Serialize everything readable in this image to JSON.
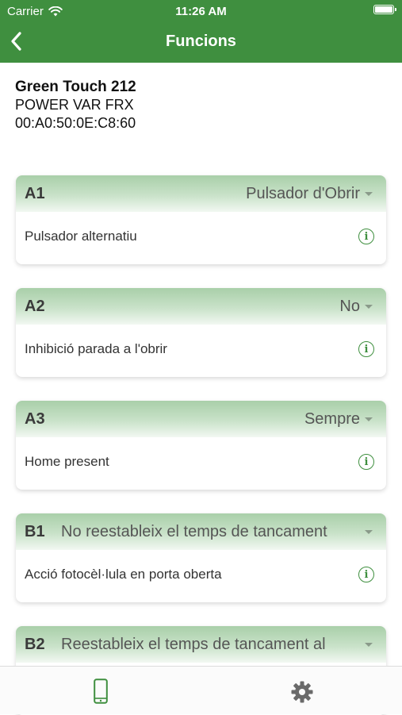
{
  "status": {
    "carrier": "Carrier",
    "time": "11:26 AM"
  },
  "nav": {
    "title": "Funcions"
  },
  "device": {
    "name": "Green Touch 212",
    "model": "POWER VAR FRX",
    "mac": "00:A0:50:0E:C8:60"
  },
  "functions": [
    {
      "code": "A1",
      "value": "Pulsador d'Obrir",
      "description": "Pulsador alternatiu"
    },
    {
      "code": "A2",
      "value": "No",
      "description": "Inhibició parada a l'obrir"
    },
    {
      "code": "A3",
      "value": "Sempre",
      "description": "Home present"
    },
    {
      "code": "B1",
      "value": "No reestableix el temps de tancament",
      "description": "Acció fotocèl·lula en porta oberta"
    },
    {
      "code": "B2",
      "value": "Reestableix el temps de tancament al",
      "description": ""
    }
  ],
  "colors": {
    "primary": "#3f8f3f",
    "header_gradient_start": "#a9cfa9"
  },
  "icons": {
    "tabs": [
      "smartphone-icon",
      "gear-icon"
    ],
    "row_action": "info-icon",
    "back": "chevron-left-icon"
  }
}
